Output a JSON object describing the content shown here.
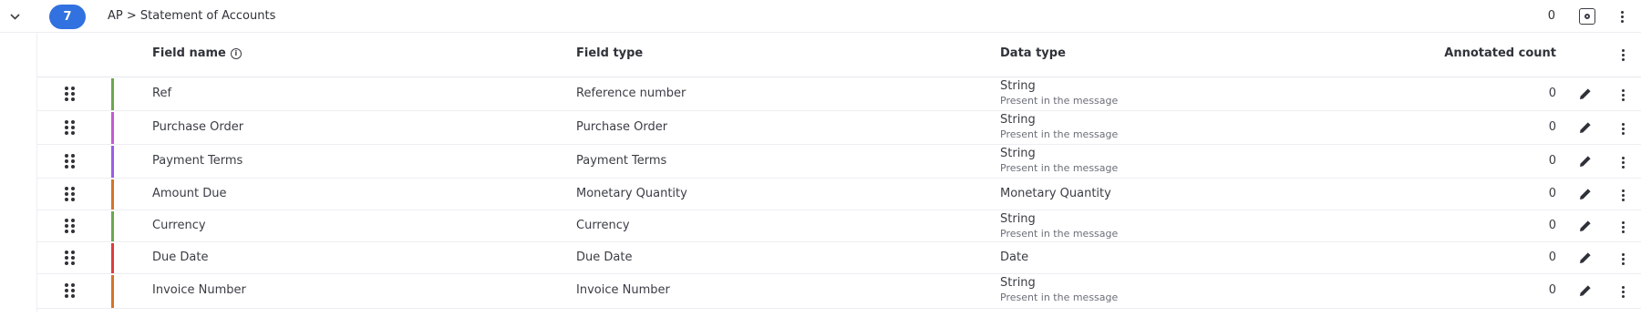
{
  "group": {
    "count_badge": "7",
    "title": "AP > Statement of Accounts",
    "annotated_total": "0"
  },
  "columns": {
    "field_name": "Field name",
    "field_type": "Field type",
    "data_type": "Data type",
    "annotated_count": "Annotated count"
  },
  "rows": [
    {
      "name": "Ref",
      "field_type": "Reference number",
      "data_type": "String",
      "data_sub": "Present in the message",
      "count": "0",
      "color": "#6aa84f"
    },
    {
      "name": "Purchase Order",
      "field_type": "Purchase Order",
      "data_type": "String",
      "data_sub": "Present in the message",
      "count": "0",
      "color": "#c45ad1"
    },
    {
      "name": "Payment Terms",
      "field_type": "Payment Terms",
      "data_type": "String",
      "data_sub": "Present in the message",
      "count": "0",
      "color": "#9b5de5"
    },
    {
      "name": "Amount Due",
      "field_type": "Monetary Quantity",
      "data_type": "Monetary Quantity",
      "data_sub": "",
      "count": "0",
      "color": "#d4742a"
    },
    {
      "name": "Currency",
      "field_type": "Currency",
      "data_type": "String",
      "data_sub": "Present in the message",
      "count": "0",
      "color": "#6aa84f"
    },
    {
      "name": "Due Date",
      "field_type": "Due Date",
      "data_type": "Date",
      "data_sub": "",
      "count": "0",
      "color": "#e03b3b"
    },
    {
      "name": "Invoice Number",
      "field_type": "Invoice Number",
      "data_type": "String",
      "data_sub": "Present in the message",
      "count": "0",
      "color": "#d4742a"
    }
  ],
  "icons": {
    "collapse": "chevron-down-icon",
    "info": "info-icon",
    "settings": "settings-icon",
    "more": "more-vertical-icon",
    "drag": "drag-handle-icon",
    "edit": "pencil-icon"
  }
}
